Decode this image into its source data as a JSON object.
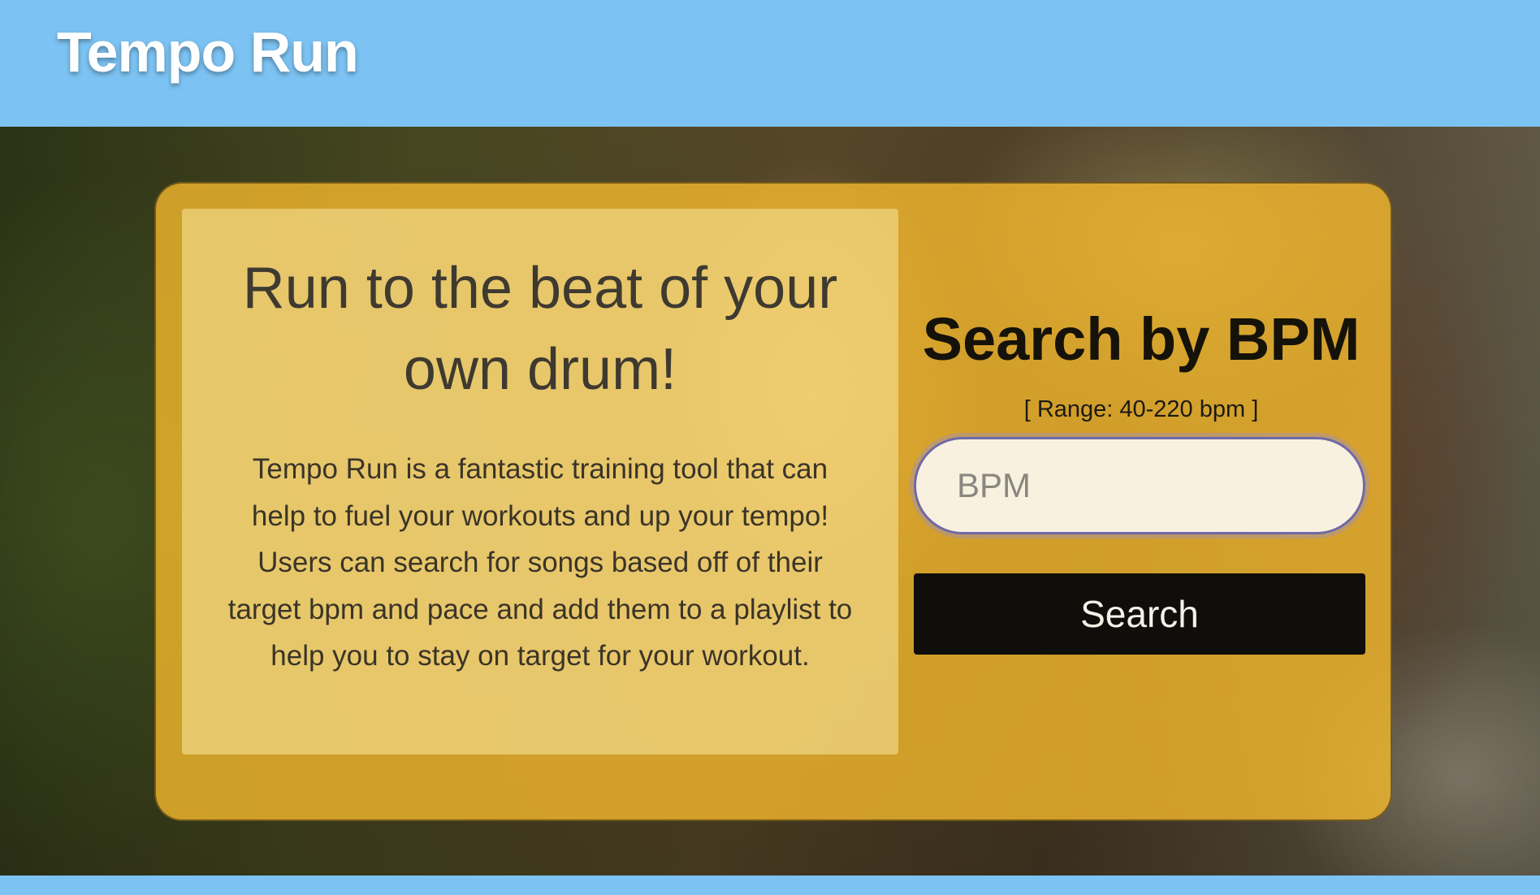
{
  "header": {
    "brand": "Tempo Run"
  },
  "hero": {
    "background_image": "runners-photo"
  },
  "info": {
    "title": "Run to the beat of your own drum!",
    "body": "Tempo Run is a fantastic training tool that can help to fuel your workouts and up your tempo! Users can search for songs based off of their target bpm and pace and add them to a playlist to help you to stay on target for your workout."
  },
  "search": {
    "title": "Search by BPM",
    "range_label": "[ Range: 40-220 bpm ]",
    "input_placeholder": "BPM",
    "input_value": "",
    "button_label": "Search"
  },
  "colors": {
    "header_bg": "#7cc3f3",
    "card_bg": "#f5b92d",
    "button_bg": "#0f0e0b"
  }
}
